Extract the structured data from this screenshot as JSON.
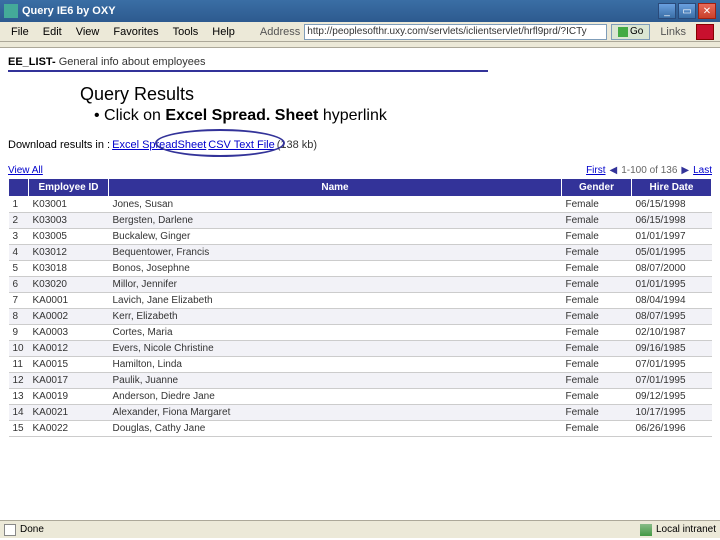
{
  "titlebar": {
    "title": "Query   IE6 by OXY"
  },
  "menu": {
    "file": "File",
    "edit": "Edit",
    "view": "View",
    "favorites": "Favorites",
    "tools": "Tools",
    "help": "Help"
  },
  "address": {
    "label": "Address",
    "value": "http://peoplesofthr.uxy.com/servlets/iclientservlet/hrfl9prd/?ICTy",
    "go": "Go",
    "links": "Links"
  },
  "page": {
    "prefix": "EE_LIST- ",
    "title": "General info about employees"
  },
  "annotation": {
    "title": "Query Results",
    "bullet_pre": "Click on ",
    "bullet_bold": "Excel Spread. Sheet",
    "bullet_post": " hyperlink"
  },
  "download": {
    "prefix": "Download results in : ",
    "excel": "Excel SpreadSheet",
    "csv": "CSV Text File",
    "size": "(138 kb)"
  },
  "nav": {
    "viewall": "View All",
    "range": "First",
    "arrows_l": "◀",
    "counter": "1-100 of 136",
    "arrows_r": "▶",
    "last": "Last"
  },
  "table": {
    "headers": {
      "empid": "Employee ID",
      "name": "Name",
      "gender": "Gender",
      "hire": "Hire Date"
    },
    "rows": [
      {
        "n": "1",
        "id": "K03001",
        "name": "Jones, Susan",
        "gender": "Female",
        "hire": "06/15/1998"
      },
      {
        "n": "2",
        "id": "K03003",
        "name": "Bergsten, Darlene",
        "gender": "Female",
        "hire": "06/15/1998"
      },
      {
        "n": "3",
        "id": "K03005",
        "name": "Buckalew, Ginger",
        "gender": "Female",
        "hire": "01/01/1997"
      },
      {
        "n": "4",
        "id": "K03012",
        "name": "Bequentower, Francis",
        "gender": "Female",
        "hire": "05/01/1995"
      },
      {
        "n": "5",
        "id": "K03018",
        "name": "Bonos, Josephne",
        "gender": "Female",
        "hire": "08/07/2000"
      },
      {
        "n": "6",
        "id": "K03020",
        "name": "Millor, Jennifer",
        "gender": "Female",
        "hire": "01/01/1995"
      },
      {
        "n": "7",
        "id": "KA0001",
        "name": "Lavich, Jane Elizabeth",
        "gender": "Female",
        "hire": "08/04/1994"
      },
      {
        "n": "8",
        "id": "KA0002",
        "name": "Kerr, Elizabeth",
        "gender": "Female",
        "hire": "08/07/1995"
      },
      {
        "n": "9",
        "id": "KA0003",
        "name": "Cortes, Maria",
        "gender": "Female",
        "hire": "02/10/1987"
      },
      {
        "n": "10",
        "id": "KA0012",
        "name": "Evers, Nicole Christine",
        "gender": "Female",
        "hire": "09/16/1985"
      },
      {
        "n": "11",
        "id": "KA0015",
        "name": "Hamilton, Linda",
        "gender": "Female",
        "hire": "07/01/1995"
      },
      {
        "n": "12",
        "id": "KA0017",
        "name": "Paulik, Juanne",
        "gender": "Female",
        "hire": "07/01/1995"
      },
      {
        "n": "13",
        "id": "KA0019",
        "name": "Anderson, Diedre Jane",
        "gender": "Female",
        "hire": "09/12/1995"
      },
      {
        "n": "14",
        "id": "KA0021",
        "name": "Alexander, Fiona Margaret",
        "gender": "Female",
        "hire": "10/17/1995"
      },
      {
        "n": "15",
        "id": "KA0022",
        "name": "Douglas, Cathy Jane",
        "gender": "Female",
        "hire": "06/26/1996"
      }
    ]
  },
  "status": {
    "done": "Done",
    "zone": "Local intranet"
  }
}
